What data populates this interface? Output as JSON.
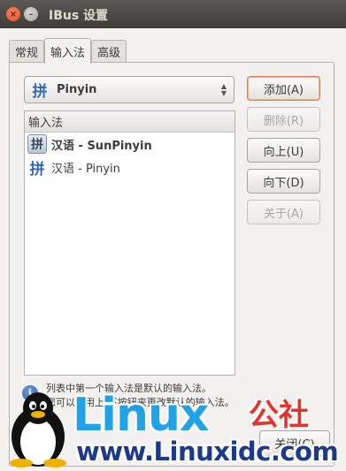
{
  "window": {
    "title": "IBus 设置",
    "close_glyph": "×",
    "minimize_glyph": "–"
  },
  "tabs": [
    {
      "label": "常规",
      "active": false
    },
    {
      "label": "输入法",
      "active": true
    },
    {
      "label": "高级",
      "active": false
    }
  ],
  "combo": {
    "icon": "pinyin-icon",
    "icon_glyph": "拼",
    "selected": "Pinyin"
  },
  "list": {
    "header": "输入法",
    "items": [
      {
        "label": "汉语 - SunPinyin",
        "icon": "sunpinyin-icon",
        "icon_glyph": "拼"
      },
      {
        "label": "汉语 - Pinyin",
        "icon": "pinyin-icon",
        "icon_glyph": "拼"
      }
    ]
  },
  "buttons": {
    "add": "添加(A)",
    "remove": "删除(R)",
    "up": "向上(U)",
    "down": "向下(D)",
    "about": "关于(A)",
    "close": "关闭(C)"
  },
  "info": {
    "icon": "info-icon",
    "glyph": "i",
    "line1": "列表中第一个输入法是默认的输入法。",
    "line2": "您可以使用上/下按钮来更改默认的输入法。"
  },
  "watermark": {
    "brand": "Linux",
    "brand_cn": "公社",
    "url": "www.Linuxidc.com"
  },
  "colors": {
    "accent_focus": "#e07a4c",
    "watermark_blue": "#1fa3e6",
    "watermark_red": "#e4322e",
    "watermark_navy": "#1d3a8a"
  }
}
